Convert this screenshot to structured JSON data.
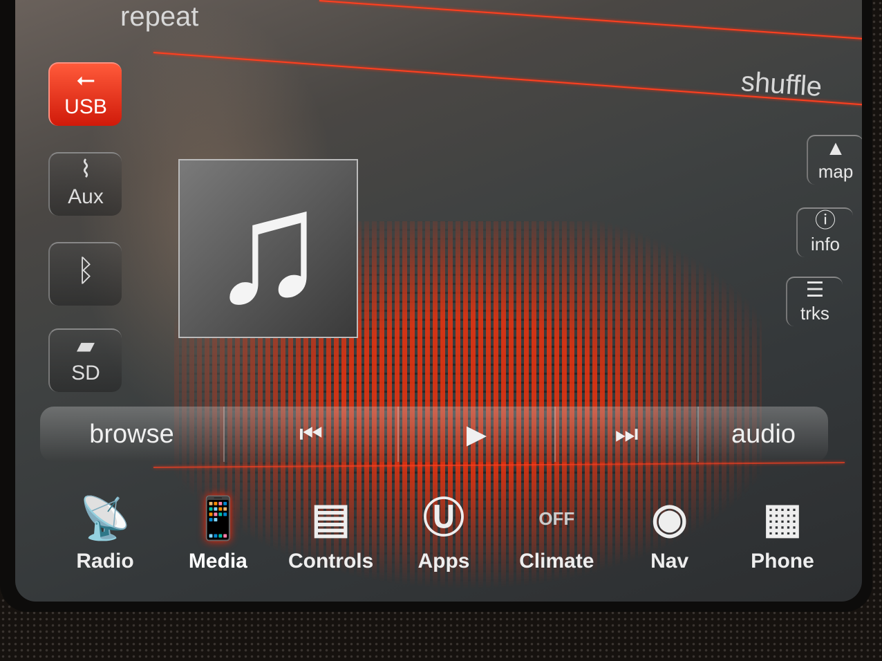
{
  "top": {
    "repeat_label": "repeat",
    "shuffle_label": "shuffle"
  },
  "sources": [
    {
      "label": "USB",
      "icon": "usb-icon",
      "glyph": "⭠",
      "active": true
    },
    {
      "label": "Aux",
      "icon": "aux-cable-icon",
      "glyph": "⌇",
      "active": false
    },
    {
      "label": "",
      "icon": "bluetooth-icon",
      "glyph": "ᛒ",
      "active": false
    },
    {
      "label": "SD",
      "icon": "sd-card-icon",
      "glyph": "▰",
      "active": false
    }
  ],
  "right_buttons": [
    {
      "label": "map",
      "icon": "map-icon",
      "glyph": "▲"
    },
    {
      "label": "info",
      "icon": "info-icon",
      "glyph": "ⓘ"
    },
    {
      "label": "trks",
      "icon": "tracks-list-icon",
      "glyph": "☰"
    }
  ],
  "album_art": {
    "icon": "music-note-icon",
    "glyph": "♫"
  },
  "transport": {
    "browse_label": "browse",
    "prev_glyph": "⏮",
    "play_glyph": "▶",
    "next_glyph": "⏭",
    "audio_label": "audio"
  },
  "nav": [
    {
      "label": "Radio",
      "icon": "radio-tower-icon",
      "glyph": "📡"
    },
    {
      "label": "Media",
      "icon": "media-phone-note-icon",
      "glyph": "📱",
      "active": true
    },
    {
      "label": "Controls",
      "icon": "seat-controls-icon",
      "glyph": "▤"
    },
    {
      "label": "Apps",
      "icon": "uconnect-apps-icon",
      "glyph": "Ⓤ"
    },
    {
      "label": "Climate",
      "icon": "climate-off-icon",
      "glyph": "OFF"
    },
    {
      "label": "Nav",
      "icon": "compass-icon",
      "glyph": "◉"
    },
    {
      "label": "Phone",
      "icon": "phone-keypad-icon",
      "glyph": "▦"
    }
  ],
  "colors": {
    "accent": "#e8301a"
  }
}
